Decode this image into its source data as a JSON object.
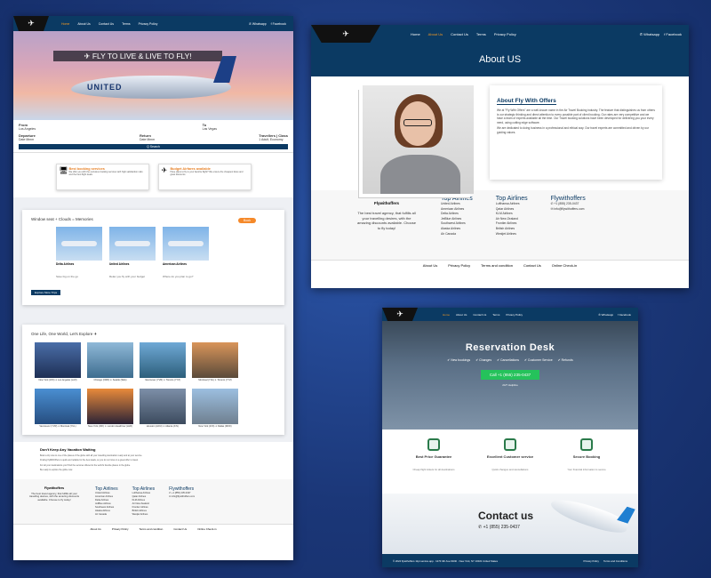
{
  "left": {
    "nav": {
      "links": [
        "Home",
        "About Us",
        "Contact Us",
        "Terms",
        "Privacy Policy"
      ],
      "right": [
        "✆ Whatsapp",
        "f Facebook"
      ]
    },
    "hero_banner": "✈ FLY TO LIVE & LIVE TO FLY!",
    "jet_text": "UNITED",
    "search": {
      "from_label": "From",
      "from_value": "Los Angeles",
      "to_label": "To",
      "to_value": "Las Vegas",
      "depart_label": "Departure",
      "depart_value": "Date Mmm",
      "return_label": "Return",
      "return_value": "Date Mmm",
      "travellers_label": "Travellers | Class",
      "travellers_value": "1 Adult, Economy",
      "button": "Q Search"
    },
    "features": [
      {
        "title": "Best booking services",
        "text": "We offer you with the exclusive booking services with high satisfaction ratio and the best flight deals."
      },
      {
        "title": "Budget Airfares available",
        "text": "Have plans to fly to your favorite flight? We ensure the cheapest fares and great discounts."
      }
    ],
    "deals_title": "Window seat + Clouds = Memories",
    "deals_button": "Book",
    "deals": [
      {
        "name": "Delta Airlines",
        "sub": "Save big on the go"
      },
      {
        "name": "United Airlines",
        "sub": "Relax you fly with your budget"
      },
      {
        "name": "American Airlines",
        "sub": "Where do you plan to go?"
      }
    ],
    "explore_button": "Explore More Trips",
    "dest_title": "One Life, One World, Let's Explore ✈",
    "destinations": [
      "New York (JFK) ✈ Los Angeles (LAX)",
      "Chicago (ORD) ✈ Seattle (SEA)",
      "Vancouver (YVR) ✈ Toronto (YYZ)",
      "Montreal (YUL) ✈ Toronto (YYZ)",
      "Vancouver (YVR) ✈ Montreal (YUL)",
      "New York (JFK) ✈ London Heathrow (LHR)",
      "Houston (HOU) ✈ Atlanta (ATL)",
      "New York (JFK) ✈ Dallas (DFW)"
    ],
    "article_title": "Don't Keep Any Vacation Waiting",
    "article": [
      "Book a trip now to one of the places of the globe with all your travelling destination ready and at your service.",
      "Finding flyWithOffers is quick and reliable for the best deals, so you do not miss on a great offer to travel.",
      "For all your destinations you'll find the services offered to the world's favorite places in the globe.",
      "Be ready to explore the globe now."
    ],
    "footer": {
      "brand": "Flywithoffers",
      "tagline": "The best travel agency, that fulfills all your travelling desires, with the amazing discounts available. Choose to fly today!",
      "col1_title": "Top Airlines",
      "col1": [
        "United Airlines",
        "American Airlines",
        "Delta Airlines",
        "JetBlue Airlines",
        "Southwest Airlines",
        "Alaska Airlines",
        "Air Canada"
      ],
      "col2_title": "Top Airlines",
      "col2": [
        "Lufthansa Airlines",
        "Qatar Airlines",
        "KLM Airlines",
        "Air New Zealand",
        "Frontier Airlines",
        "British Airlines",
        "Westjet Airlines"
      ],
      "col3_title": "Flywithoffers",
      "col3": [
        "✆ +1 (855) 235-0437",
        "✉ info@flywithoffers.com"
      ],
      "bar": [
        "About Us",
        "Privacy Policy",
        "Terms and condition",
        "Contact Us",
        "Online Check-in"
      ]
    }
  },
  "about": {
    "nav": {
      "links": [
        "Home",
        "About Us",
        "Contact Us",
        "Terms",
        "Privacy Policy"
      ],
      "right": [
        "✆ Whatsapp",
        "f Facebook"
      ]
    },
    "band": "About US",
    "card_title": "About Fly With Offers",
    "paragraphs": [
      "We at \"Fly With Offers\" are a well-known name in the Air Travel Booking industry. The feature that distinguishes us from others is our strategic thinking and direct attention to every possible part of client booking. Our rates are very competitive and we have a team of experts available all the time. Our Travel booking solutions have been developed for delivering you your every need, using cutting edge software.",
      "We are dedicated to doing business in a professional and ethical way. Our travel experts are committed and driven by our guiding values."
    ],
    "footer": {
      "brand": "Flywithoffers",
      "tagline": "The best travel agency, that fulfills all your travelling desires, with the amazing discounts available. Choose to fly today!",
      "col1_title": "Top Airlines",
      "col1": [
        "United Airlines",
        "American Airlines",
        "Delta Airlines",
        "JetBlue Airlines",
        "Southwest Airlines",
        "Alaska Airlines",
        "Air Canada"
      ],
      "col2_title": "Top Airlines",
      "col2": [
        "Lufthansa Airlines",
        "Qatar Airlines",
        "KLM Airlines",
        "Air New Zealand",
        "Frontier Airlines",
        "British Airlines",
        "Westjet Airlines"
      ],
      "col3_title": "Flywithoffers",
      "col3": [
        "✆ +1 (855) 235-0437",
        "✉ info@flywithoffers.com"
      ],
      "bar": [
        "About Us",
        "Privacy Policy",
        "Terms and condition",
        "Contact Us",
        "Online Check-in"
      ]
    }
  },
  "reservation": {
    "nav": {
      "links": [
        "Home",
        "About Us",
        "Contact Us",
        "Terms",
        "Privacy Policy"
      ],
      "right": [
        "✆ Whatsapp",
        "f Facebook"
      ]
    },
    "title": "Reservation Desk",
    "items": [
      "✔ New bookings",
      "✔ Changes",
      "✔ Cancellations",
      "✔ Customer Service",
      "✔ Refunds"
    ],
    "call_button": "Call +1 (855) 235-0437",
    "availability": "24/7 Helpline",
    "features": [
      {
        "title": "Best Price Guarantee",
        "sub": "Cheap flight tickets for all destinations"
      },
      {
        "title": "Excellent Customer service",
        "sub": "Quick changes and cancellations"
      },
      {
        "title": "Secure Booking",
        "sub": "Your financial information is secure"
      }
    ],
    "contact_title": "Contact us",
    "contact_phone": "✆ +1 (855) 235-0437",
    "bottom_left": "© 2024 flywithoffers 11pt service.app · 1270 4th Ave #10th · New York, NY 10021 United States",
    "bottom_right": [
      "Privacy Policy",
      "Terms and Conditions"
    ]
  }
}
